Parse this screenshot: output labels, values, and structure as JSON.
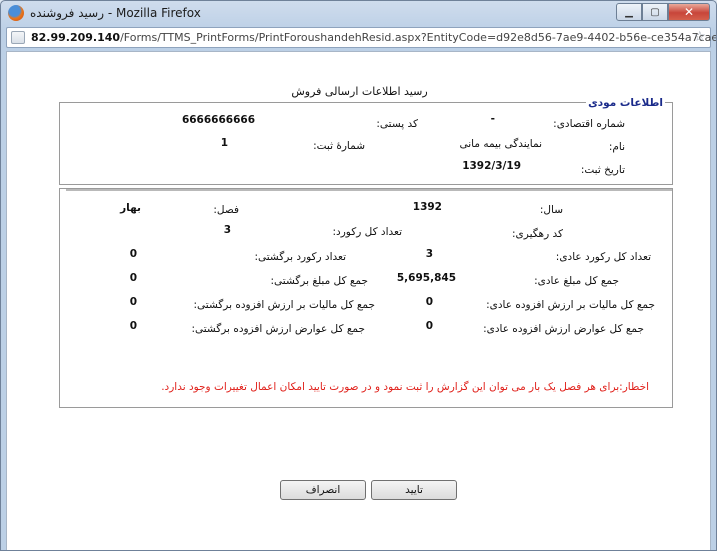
{
  "window": {
    "title": "رسید فروشنده - Mozilla Firefox",
    "minimize_label": "▁",
    "maximize_label": "▢",
    "close_label": "✕"
  },
  "urlbar": {
    "host": "82.99.209.140",
    "path": "/Forms/TTMS_PrintForms/PrintForoushandehResid.aspx?EntityCode=d92e8d56-7ae9-4402-b56e-ce354a7caee4",
    "star_icon": "☆"
  },
  "page": {
    "title": "رسید اطلاعات ارسالی فروش",
    "taxpayer_section": {
      "legend": "اطلاعات مودی",
      "economic_code_label": "شماره اقتصادی:",
      "economic_code_value": "-",
      "postal_code_label": "کد پستی:",
      "postal_code_value": "6666666666",
      "name_label": "نام:",
      "name_value": "نمایندگی بیمه مانی",
      "reg_number_label": "شمارهٔ ثبت:",
      "reg_number_value": "1",
      "reg_date_label": "تاریخ ثبت:",
      "reg_date_value": "1392/3/19"
    },
    "report_section": {
      "year_label": "سال:",
      "year_value": "1392",
      "season_label": "فصل:",
      "season_value": "بهار",
      "tracking_label": "کد رهگیری:",
      "total_records_label": "تعداد کل رکورد:",
      "total_records_value": "3",
      "normal_records_label": "تعداد کل رکورد عادی:",
      "normal_records_value": "3",
      "returned_records_label": "تعداد رکورد برگشتی:",
      "returned_records_value": "0",
      "normal_amount_label": "جمع کل مبلغ عادی:",
      "normal_amount_value": "5,695,845",
      "returned_amount_label": "جمع کل مبلغ برگشتی:",
      "returned_amount_value": "0",
      "normal_vat_label": "جمع کل مالیات بر ارزش افزوده عادی:",
      "normal_vat_value": "0",
      "returned_vat_label": "جمع کل مالیات بر ارزش افزوده برگشتی:",
      "returned_vat_value": "0",
      "normal_duties_label": "جمع کل عوارض ارزش افزوده عادی:",
      "normal_duties_value": "0",
      "returned_duties_label": "جمع کل عوارض ارزش افزوده برگشتی:",
      "returned_duties_value": "0",
      "warning": "اخطار:برای هر فصل یک بار می توان این گزارش را ثبت نمود و در صورت تایید امکان اعمال تغییرات وجود ندارد."
    },
    "confirm_button": "تایید",
    "cancel_button": "انصراف"
  },
  "colors": {
    "warning": "#e0201a",
    "legend": "#1a2a8a"
  }
}
